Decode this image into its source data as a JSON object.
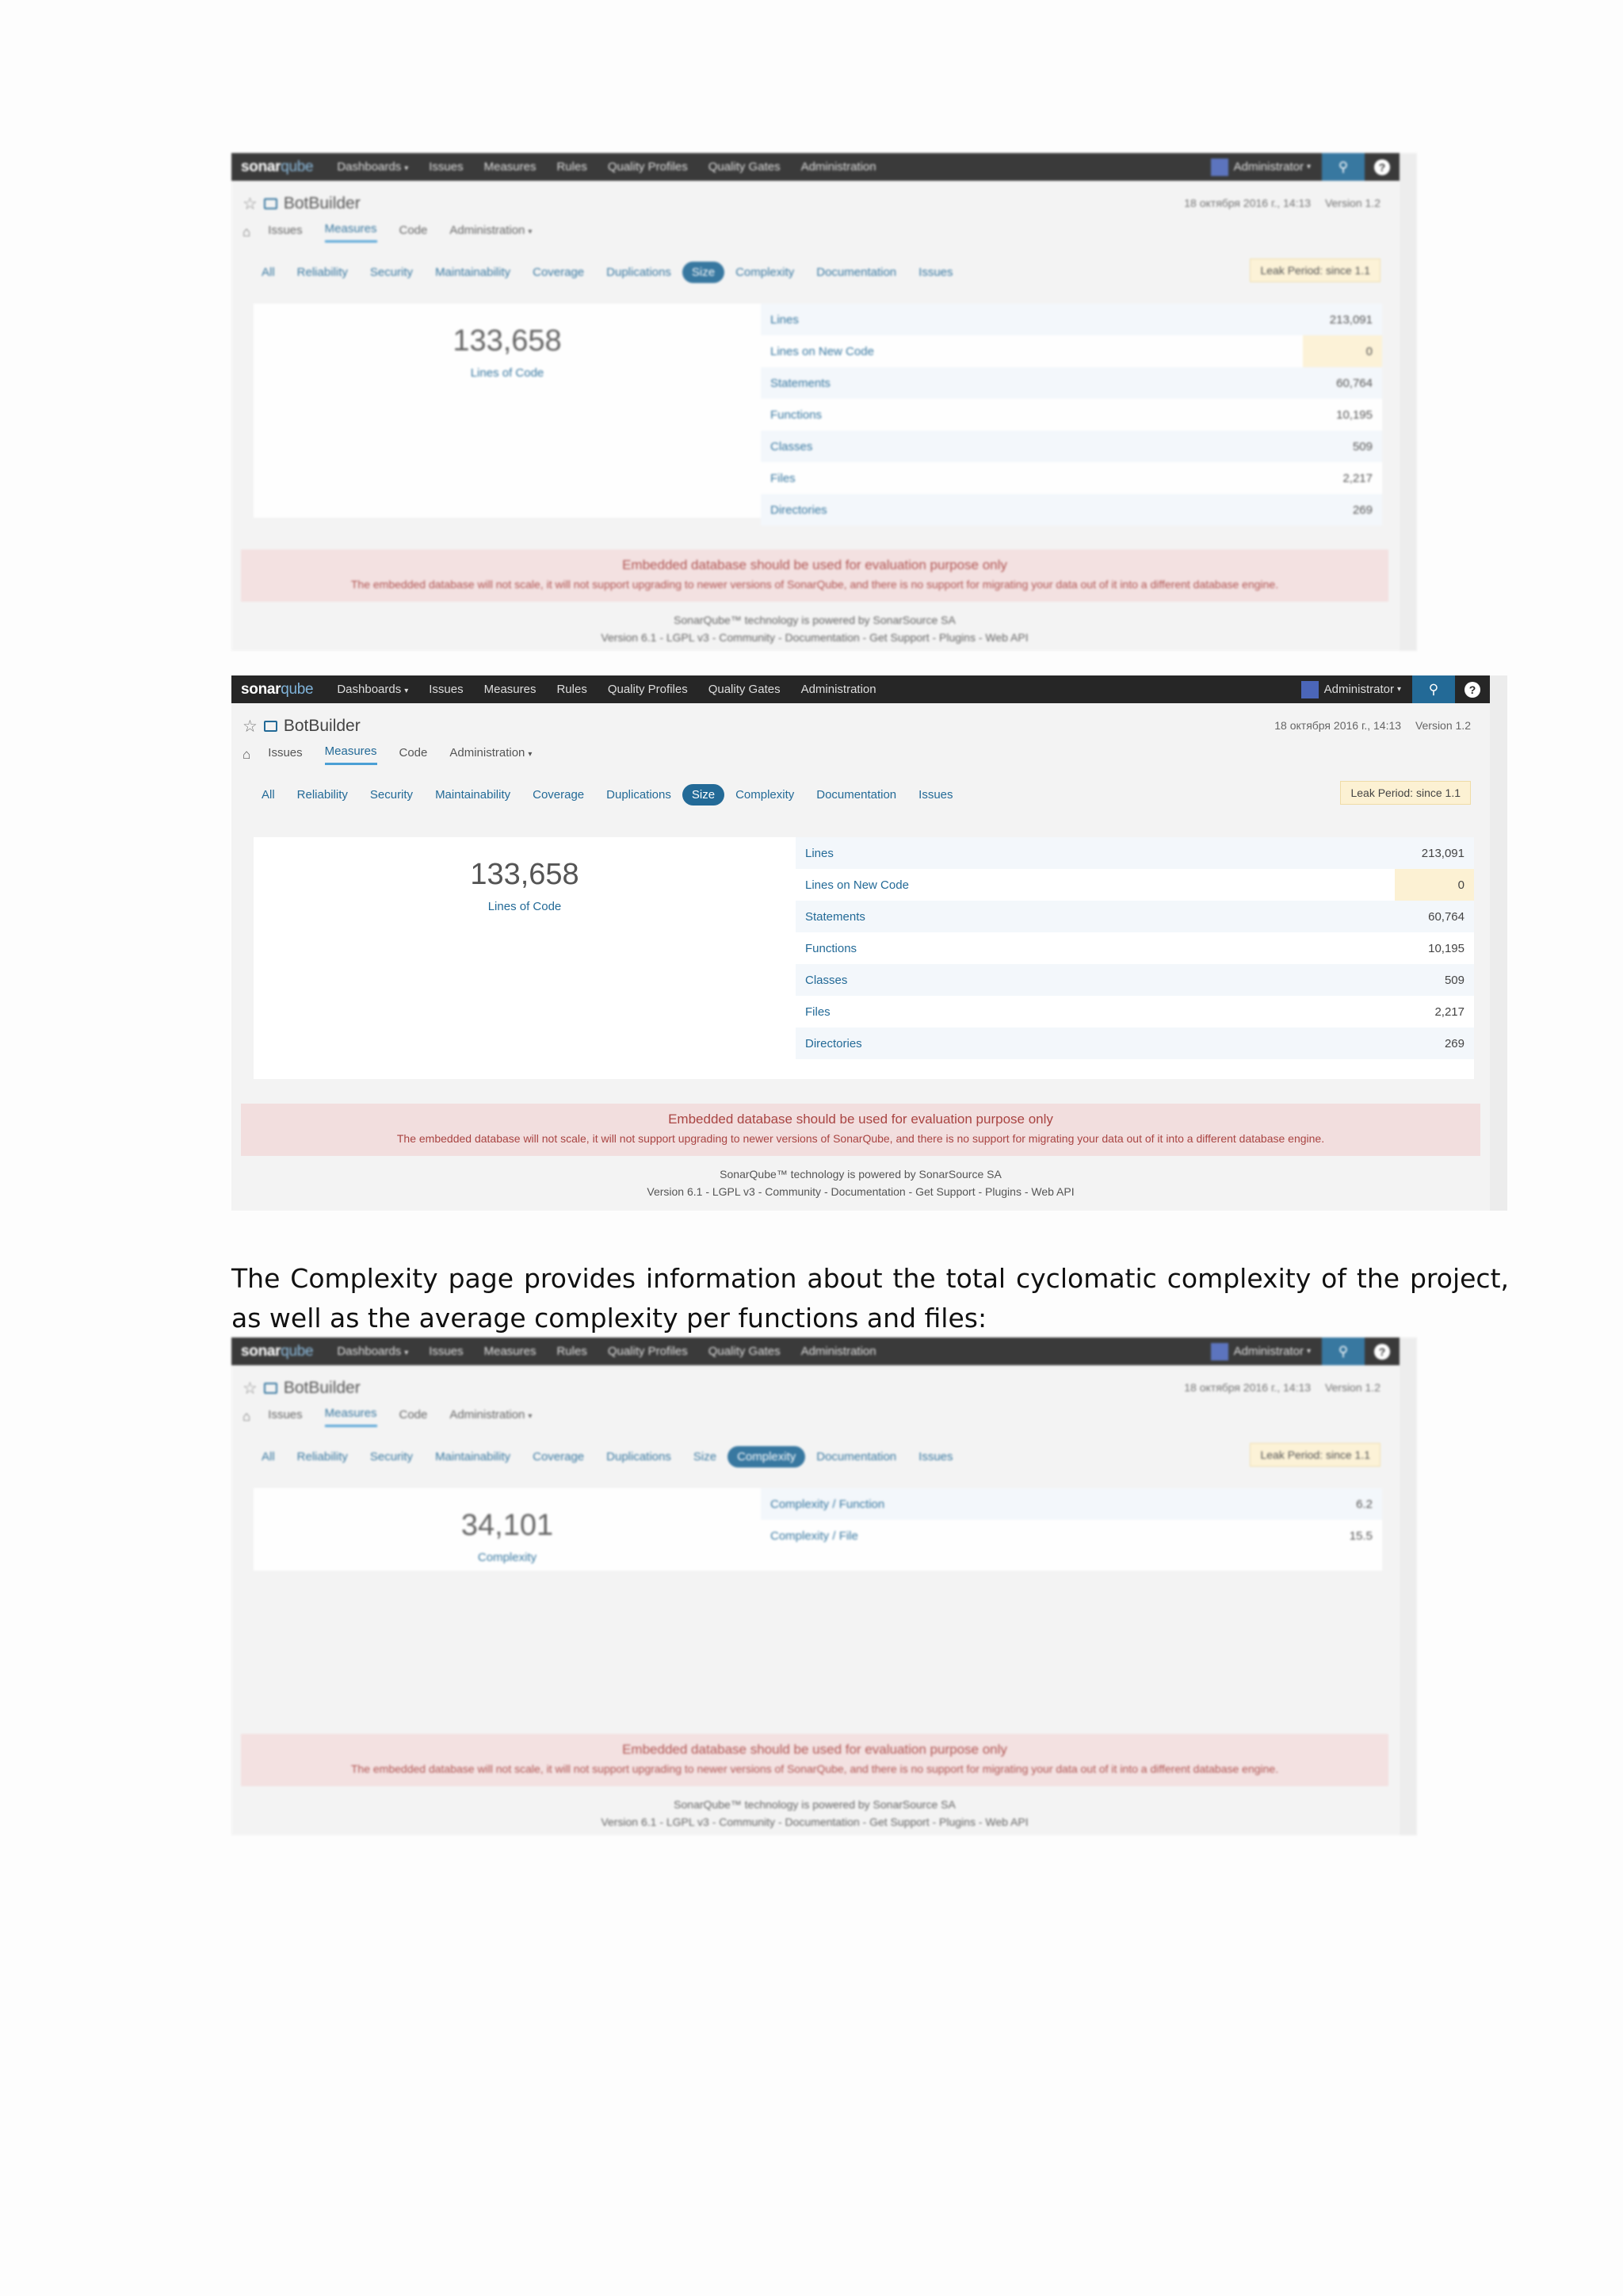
{
  "navbar": {
    "logo_main": "sonar",
    "logo_accent": "qube",
    "items": [
      "Dashboards",
      "Issues",
      "Measures",
      "Rules",
      "Quality Profiles",
      "Quality Gates",
      "Administration"
    ],
    "user": "Administrator"
  },
  "project": {
    "name": "BotBuilder",
    "date": "18 октября 2016 г., 14:13",
    "version": "Version 1.2"
  },
  "subnav": [
    "Issues",
    "Measures",
    "Code",
    "Administration"
  ],
  "tabs": [
    "All",
    "Reliability",
    "Security",
    "Maintainability",
    "Coverage",
    "Duplications",
    "Size",
    "Complexity",
    "Documentation",
    "Issues"
  ],
  "leak_period": "Leak Period: since 1.1",
  "size": {
    "summary_value": "133,658",
    "summary_label": "Lines of Code",
    "rows": [
      {
        "name": "Lines",
        "value": "213,091"
      },
      {
        "name": "Lines on New Code",
        "value": "0"
      },
      {
        "name": "Statements",
        "value": "60,764"
      },
      {
        "name": "Functions",
        "value": "10,195"
      },
      {
        "name": "Classes",
        "value": "509"
      },
      {
        "name": "Files",
        "value": "2,217"
      },
      {
        "name": "Directories",
        "value": "269"
      }
    ]
  },
  "complexity": {
    "summary_value": "34,101",
    "summary_label": "Complexity",
    "rows": [
      {
        "name": "Complexity / Function",
        "value": "6.2"
      },
      {
        "name": "Complexity / File",
        "value": "15.5"
      }
    ]
  },
  "banner": {
    "title": "Embedded database should be used for evaluation purpose only",
    "text": "The embedded database will not scale, it will not support upgrading to newer versions of SonarQube, and there is no support for migrating your data out of it into a different database engine."
  },
  "footer": {
    "line1": "SonarQube™ technology is powered by SonarSource SA",
    "line2": "Version 6.1 - LGPL v3 - Community - Documentation - Get Support - Plugins - Web API"
  },
  "paragraph": "The Complexity page provides information about the total cyclomatic complexity of the project, as well as the average complexity per functions and files:"
}
